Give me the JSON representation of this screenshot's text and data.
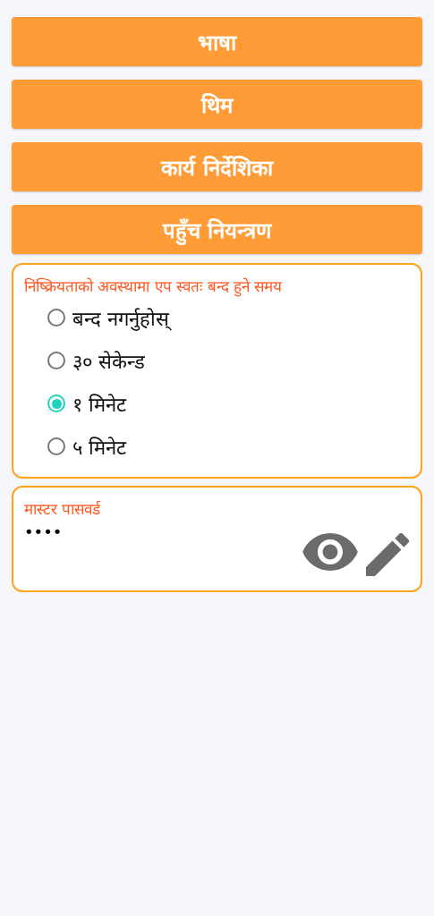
{
  "menu_buttons": [
    "भाषा",
    "थिम",
    "कार्य निर्देशिका",
    "पहुँच नियन्त्रण"
  ],
  "auto_lock": {
    "label": "निष्क्रियताको अवस्थामा एप स्वतः बन्द हुने समय",
    "options": [
      {
        "label": "बन्द नगर्नुहोस्",
        "selected": false
      },
      {
        "label": "३० सेकेन्ड",
        "selected": false
      },
      {
        "label": "१ मिनेट",
        "selected": true
      },
      {
        "label": "५ मिनेट",
        "selected": false
      }
    ]
  },
  "master_password": {
    "label": "मास्टर पासवर्ड",
    "value": "••••"
  }
}
